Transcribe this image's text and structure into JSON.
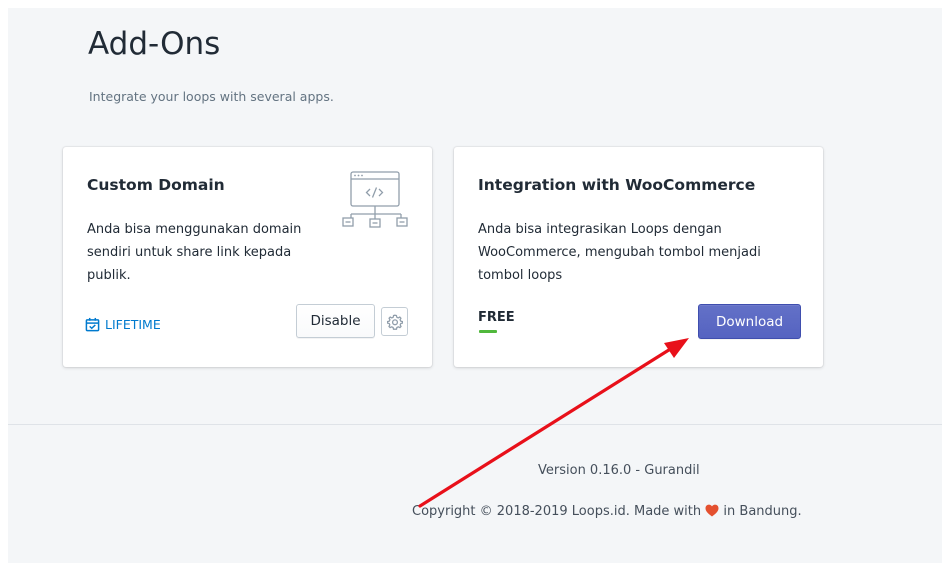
{
  "page": {
    "title": "Add-Ons",
    "subtitle": "Integrate your loops with several apps."
  },
  "cards": [
    {
      "title": "Custom Domain",
      "description": "Anda bisa menggunakan domain sendiri untuk share link kepada publik.",
      "illustration_icon": "code-sitemap-icon",
      "badge_icon": "calendar-check-icon",
      "badge_label": "LIFETIME",
      "action_label": "Disable",
      "settings_icon": "gear-icon"
    },
    {
      "title": "Integration with WooCommerce",
      "description": "Anda bisa integrasikan Loops dengan WooCommerce, mengubah tombol menjadi tombol loops",
      "price_label": "FREE",
      "action_label": "Download"
    }
  ],
  "footer": {
    "version": "Version 0.16.0 - Gurandil",
    "copyright_prefix": "Copyright © 2018-2019 Loops.id. Made with",
    "heart_icon": "heart-icon",
    "copyright_suffix": "in Bandung."
  },
  "colors": {
    "accent": "#5c6ac4",
    "link": "#007ace",
    "background": "#f4f6f8",
    "annotation_arrow": "#e8101a",
    "heart": "#e4502f",
    "free_green": "#50b83c"
  }
}
